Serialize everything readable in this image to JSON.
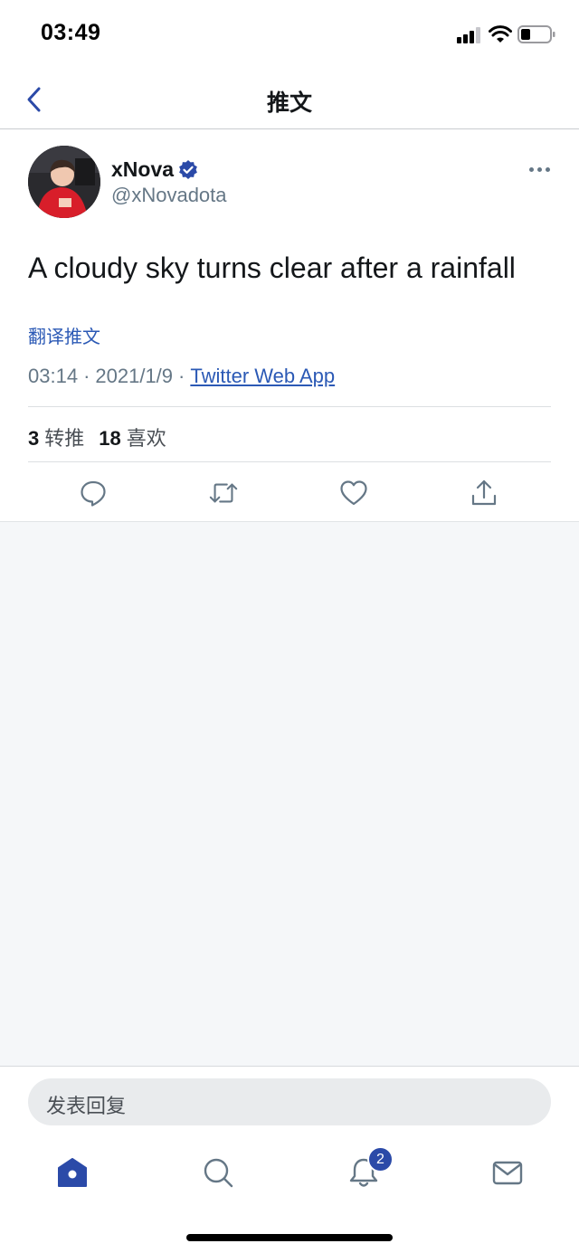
{
  "status_bar": {
    "time": "03:49"
  },
  "nav": {
    "title": "推文",
    "back_icon": "chevron-left-icon"
  },
  "tweet": {
    "display_name": "xNova",
    "handle": "@xNovadota",
    "verified": true,
    "text": "A cloudy sky turns clear after a rainfall",
    "translate_label": "翻译推文",
    "time": "03:14",
    "date": "2021/1/9",
    "source": "Twitter Web App",
    "separator": "·",
    "retweets_count": "3",
    "retweets_label": "转推",
    "likes_count": "18",
    "likes_label": "喜欢"
  },
  "actions": [
    "reply-icon",
    "retweet-icon",
    "like-icon",
    "share-icon"
  ],
  "reply_bar": {
    "placeholder": "发表回复"
  },
  "tab_bar": {
    "items": [
      "home-icon",
      "search-icon",
      "notifications-icon",
      "messages-icon"
    ],
    "notifications_badge": "2"
  },
  "colors": {
    "accent": "#2b4aa8",
    "link": "#2b59b5",
    "secondary_text": "#657786",
    "background_gray": "#f5f7f9"
  }
}
